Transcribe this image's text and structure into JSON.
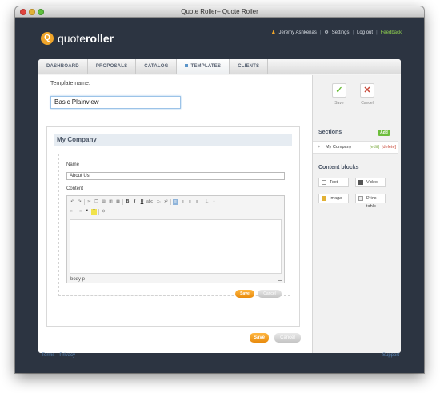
{
  "window": {
    "title": "Quote Roller– Quote Roller"
  },
  "logo": {
    "letter": "Q",
    "text_regular": "quote",
    "text_bold": "roller"
  },
  "toplinks": {
    "user": "Jeremy Ashkenas",
    "settings": "Settings",
    "logout": "Log out",
    "feedback": "Feedback"
  },
  "tabs": [
    {
      "label": "DASHBOARD"
    },
    {
      "label": "PROPOSALS"
    },
    {
      "label": "CATALOG"
    },
    {
      "label": "TEMPLATES"
    },
    {
      "label": "CLIENTS"
    }
  ],
  "template": {
    "label": "Template name:",
    "value": "Basic Plainview"
  },
  "section": {
    "title": "My Company",
    "name_label": "Name",
    "name_value": "About Us",
    "content_label": "Content",
    "status": "body  p",
    "save": "Save",
    "cancel": "Cancel"
  },
  "page_actions": {
    "save": "Save",
    "cancel": "Cancel"
  },
  "sidebar": {
    "save": "Save",
    "cancel": "Cancel",
    "sections_title": "Sections",
    "add": "Add",
    "section_item": {
      "name": "My Company",
      "edit": "[edit]",
      "delete": "[delete]"
    },
    "blocks_title": "Content blocks",
    "blocks": [
      {
        "label": "Text"
      },
      {
        "label": "Video"
      },
      {
        "label": "Image"
      },
      {
        "label": "Price table"
      }
    ]
  },
  "footer": {
    "terms": "Terms",
    "privacy": "Privacy",
    "support": "Support"
  },
  "colors": {
    "accent": "#f0a52a",
    "background": "#2c3441",
    "feedback": "#8fd14f"
  }
}
